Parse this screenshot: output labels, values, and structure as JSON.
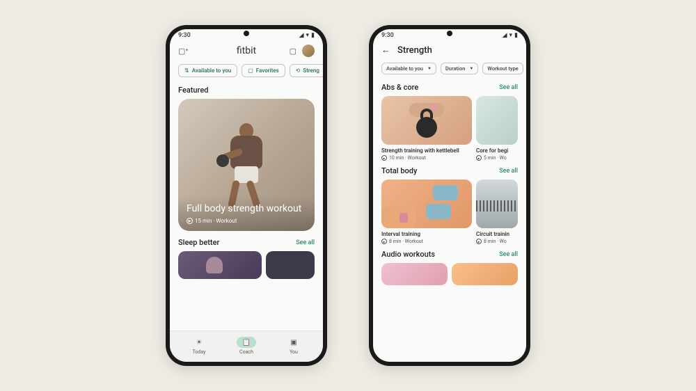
{
  "status": {
    "time": "9:30",
    "signal_icon": "signal-icon",
    "wifi_icon": "wifi-icon",
    "battery_icon": "battery-icon"
  },
  "phone1": {
    "header": {
      "title": "fitbit",
      "cast_icon": "cast-icon",
      "message_icon": "message-icon",
      "avatar": "user-avatar"
    },
    "chips": [
      {
        "icon": "⇅",
        "label": "Available to you"
      },
      {
        "icon": "▢",
        "label": "Favorites"
      },
      {
        "icon": "⟲",
        "label": "Streng"
      }
    ],
    "featured": {
      "heading": "Featured",
      "title": "Full body strength workout",
      "meta": "15 min · Workout"
    },
    "sleep": {
      "heading": "Sleep better",
      "see_all": "See all"
    },
    "nav": [
      {
        "icon": "☀",
        "label": "Today",
        "active": false
      },
      {
        "icon": "📋",
        "label": "Coach",
        "active": true
      },
      {
        "icon": "▣",
        "label": "You",
        "active": false
      }
    ]
  },
  "phone2": {
    "header": {
      "title": "Strength",
      "back_icon": "back-icon"
    },
    "chips": [
      {
        "label": "Available to you"
      },
      {
        "label": "Duration"
      },
      {
        "label": "Workout type"
      }
    ],
    "sections": [
      {
        "heading": "Abs & core",
        "see_all": "See all",
        "items": [
          {
            "title": "Strength training with kettlebell",
            "meta": "10 min · Workout"
          },
          {
            "title": "Core for begi",
            "meta": "5 min · Wo"
          }
        ]
      },
      {
        "heading": "Total body",
        "see_all": "See all",
        "items": [
          {
            "title": "Interval training",
            "meta": "8 min · Workout"
          },
          {
            "title": "Circuit trainin",
            "meta": "8 min · Wo"
          }
        ]
      },
      {
        "heading": "Audio workouts",
        "see_all": "See all"
      }
    ]
  }
}
